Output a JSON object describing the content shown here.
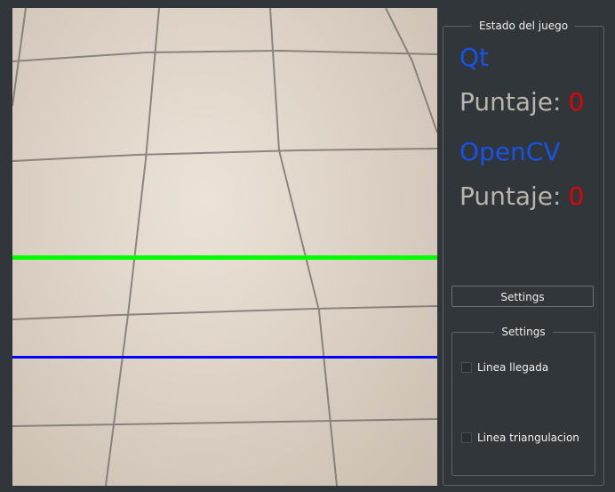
{
  "status_group": {
    "title": "Estado del juego",
    "player1_name": "Qt",
    "score_label": "Puntaje:",
    "player1_score": "0",
    "player2_name": "OpenCV",
    "player2_score": "0"
  },
  "settings_button": {
    "label": "Settings"
  },
  "settings_group": {
    "title": "Settings",
    "checkbox_finish": {
      "label": "Linea llegada",
      "checked": false
    },
    "checkbox_triangulation": {
      "label": "Linea triangulacion",
      "checked": false
    }
  },
  "colors": {
    "player_name": "#1753e6",
    "score_value": "#e50000",
    "finish_line": "#00ff00",
    "triangulation_line": "#0000ff"
  }
}
